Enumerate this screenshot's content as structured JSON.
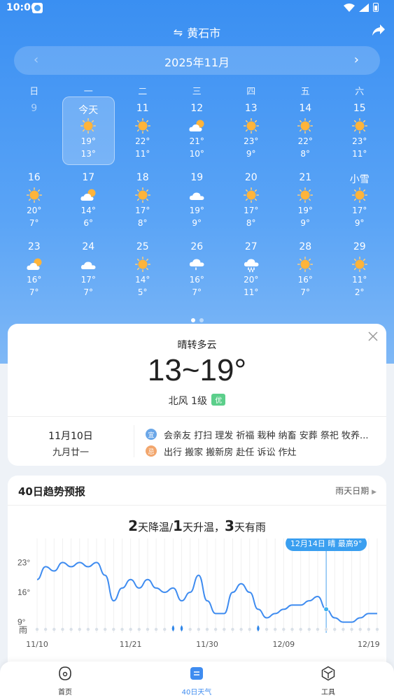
{
  "status": {
    "time": "10:06"
  },
  "header": {
    "city": "黄石市",
    "swap_icon": "⇋"
  },
  "month": {
    "label": "2025年11月"
  },
  "weekdays": [
    "日",
    "一",
    "二",
    "三",
    "四",
    "五",
    "六"
  ],
  "calendar": [
    [
      {
        "day": "9",
        "empty": true
      },
      {
        "day": "今天",
        "icon": "sun",
        "hi": "19°",
        "lo": "13°",
        "today": true
      },
      {
        "day": "11",
        "icon": "sun",
        "hi": "22°",
        "lo": "11°"
      },
      {
        "day": "12",
        "icon": "partly-cloudy",
        "hi": "21°",
        "lo": "10°"
      },
      {
        "day": "13",
        "icon": "sun",
        "hi": "23°",
        "lo": "9°"
      },
      {
        "day": "14",
        "icon": "sun",
        "hi": "22°",
        "lo": "8°"
      },
      {
        "day": "15",
        "icon": "sun",
        "hi": "23°",
        "lo": "11°"
      }
    ],
    [
      {
        "day": "16",
        "icon": "sun",
        "hi": "20°",
        "lo": "7°"
      },
      {
        "day": "17",
        "icon": "partly-cloudy",
        "hi": "14°",
        "lo": "6°"
      },
      {
        "day": "18",
        "icon": "sun",
        "hi": "17°",
        "lo": "8°"
      },
      {
        "day": "19",
        "icon": "cloud",
        "hi": "19°",
        "lo": "9°"
      },
      {
        "day": "20",
        "icon": "sun",
        "hi": "17°",
        "lo": "8°"
      },
      {
        "day": "21",
        "icon": "sun",
        "hi": "19°",
        "lo": "9°"
      },
      {
        "day": "小雪",
        "icon": "sun",
        "hi": "17°",
        "lo": "9°"
      }
    ],
    [
      {
        "day": "23",
        "icon": "partly-cloudy",
        "hi": "16°",
        "lo": "7°"
      },
      {
        "day": "24",
        "icon": "cloud",
        "hi": "17°",
        "lo": "7°"
      },
      {
        "day": "25",
        "icon": "sun",
        "hi": "14°",
        "lo": "5°"
      },
      {
        "day": "26",
        "icon": "light-rain",
        "hi": "16°",
        "lo": "7°"
      },
      {
        "day": "27",
        "icon": "moderate-rain",
        "hi": "20°",
        "lo": "11°"
      },
      {
        "day": "28",
        "icon": "sun",
        "hi": "16°",
        "lo": "7°"
      },
      {
        "day": "29",
        "icon": "sun",
        "hi": "11°",
        "lo": "2°"
      }
    ]
  ],
  "today_card": {
    "condition": "晴转多云",
    "temp_range": "13~19°",
    "wind": "北风 1级",
    "air_quality": "优",
    "date_gregorian": "11月10日",
    "date_lunar": "九月廿一",
    "yi_badge": "宜",
    "ji_badge": "忌",
    "yi_text": "会亲友 打扫 理发 祈福 栽种 纳畜 安葬 祭祀 牧养...",
    "ji_text": "出行 搬家 搬新房 赴任 诉讼 作灶"
  },
  "trend": {
    "title": "40日趋势预报",
    "link": "雨天日期",
    "summary": {
      "n1": "2",
      "t1": "天降温/",
      "n2": "1",
      "t2": "天升温，",
      "n3": "3",
      "t3": "天有雨"
    },
    "tooltip": "12月14日 晴 最高9°",
    "rain_label": "雨"
  },
  "chart_data": {
    "type": "line",
    "y_ticks": [
      "23°",
      "16°",
      "9°"
    ],
    "x_ticks": [
      "11/10",
      "11/21",
      "11/30",
      "12/09",
      "12/19"
    ],
    "ylim": [
      4,
      27
    ],
    "series": [
      {
        "values": [
          19,
          22,
          21,
          23,
          22,
          23,
          22,
          23,
          20,
          14,
          17,
          19,
          17,
          19,
          17,
          16,
          17,
          14,
          16,
          20,
          14,
          11,
          11,
          16,
          18,
          16,
          12,
          10,
          11,
          12,
          13,
          13,
          14,
          15,
          12,
          10,
          9,
          9,
          10,
          11,
          11
        ]
      }
    ],
    "highlight_index": 34,
    "rain_days": [
      16,
      17,
      26
    ]
  },
  "nav": [
    {
      "label": "首页",
      "icon": "home-icon"
    },
    {
      "label": "40日天气",
      "icon": "calendar-icon",
      "active": true
    },
    {
      "label": "工具",
      "icon": "tools-icon"
    }
  ]
}
